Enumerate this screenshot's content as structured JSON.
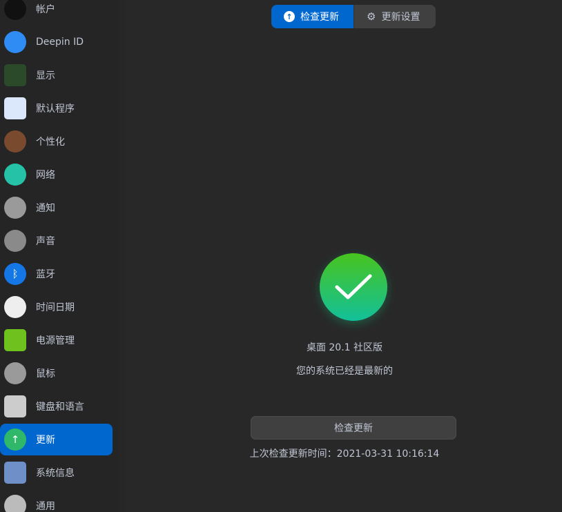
{
  "sidebar": {
    "items": [
      {
        "label": "帐户",
        "icon": "account-icon",
        "color": "#111111"
      },
      {
        "label": "Deepin ID",
        "icon": "cloud-icon",
        "color": "#2f8cf5"
      },
      {
        "label": "显示",
        "icon": "display-icon",
        "color": "#2a4a2a"
      },
      {
        "label": "默认程序",
        "icon": "default-apps-icon",
        "color": "#dbe8fb"
      },
      {
        "label": "个性化",
        "icon": "palette-icon",
        "color": "#7a4a2e"
      },
      {
        "label": "网络",
        "icon": "network-icon",
        "color": "#26c2a8"
      },
      {
        "label": "通知",
        "icon": "bell-icon",
        "color": "#9a9a9a"
      },
      {
        "label": "声音",
        "icon": "speaker-icon",
        "color": "#8a8a8a"
      },
      {
        "label": "蓝牙",
        "icon": "bluetooth-icon",
        "color": "#1577e6"
      },
      {
        "label": "时间日期",
        "icon": "clock-icon",
        "color": "#eeeeee"
      },
      {
        "label": "电源管理",
        "icon": "battery-icon",
        "color": "#6fc21e"
      },
      {
        "label": "鼠标",
        "icon": "mouse-icon",
        "color": "#9a9a9a"
      },
      {
        "label": "键盘和语言",
        "icon": "keyboard-icon",
        "color": "#cccccc"
      },
      {
        "label": "更新",
        "icon": "update-icon",
        "color": "#2fb86a"
      },
      {
        "label": "系统信息",
        "icon": "system-info-icon",
        "color": "#6e8fc7"
      },
      {
        "label": "通用",
        "icon": "general-icon",
        "color": "#bbbbbb"
      }
    ],
    "selected": 13
  },
  "tabs": {
    "check": "检查更新",
    "settings": "更新设置"
  },
  "main": {
    "version": "桌面 20.1 社区版",
    "status": "您的系统已经是最新的",
    "button": "检查更新",
    "last_check": "上次检查更新时间：2021-03-31 10:16:14"
  },
  "colors": {
    "accent": "#0067cf",
    "success": "#2fc05a"
  }
}
